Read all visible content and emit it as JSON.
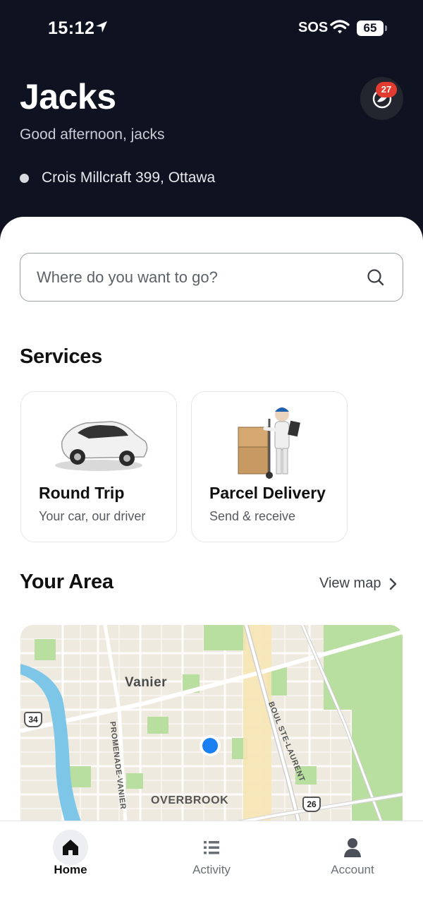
{
  "status_bar": {
    "time": "15:12",
    "carrier": "SOS",
    "battery": "65"
  },
  "header": {
    "title": "Jacks",
    "greeting": "Good afternoon, jacks",
    "address": "Crois Millcraft 399, Ottawa",
    "notification_count": "27"
  },
  "search": {
    "placeholder": "Where do you want to go?"
  },
  "services": {
    "title": "Services",
    "items": [
      {
        "title": "Round Trip",
        "subtitle": "Your car, our driver",
        "icon": "car-icon"
      },
      {
        "title": "Parcel Delivery",
        "subtitle": "Send & receive",
        "icon": "delivery-person-icon"
      }
    ]
  },
  "area": {
    "title": "Your Area",
    "view_map": "View map",
    "map": {
      "labels": {
        "vanier": "Vanier",
        "overbrook": "OVERBROOK",
        "promenade": "PROMENADE-VANIER",
        "boul": "BOUL STE-LAURENT"
      },
      "route_shields": [
        "34",
        "26"
      ]
    }
  },
  "nav": {
    "items": [
      {
        "label": "Home",
        "icon": "home-icon",
        "active": true
      },
      {
        "label": "Activity",
        "icon": "list-icon",
        "active": false
      },
      {
        "label": "Account",
        "icon": "person-icon",
        "active": false
      }
    ]
  },
  "colors": {
    "header_bg": "#0f1220",
    "badge": "#e23b30",
    "location_dot": "#1a7ff0"
  }
}
